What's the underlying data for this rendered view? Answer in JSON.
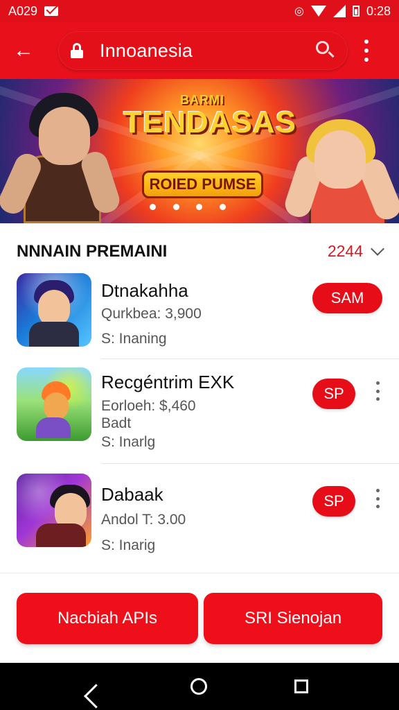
{
  "status_bar": {
    "left_text": "A029",
    "right_text": "0:28"
  },
  "app_bar": {
    "title": "Innoanesia"
  },
  "banner": {
    "title_small": "BARMI",
    "title_main": "TENDASAS",
    "subtitle": "ROIED PUMSE",
    "indicator_count": 4
  },
  "section": {
    "title": "NNNAIN PREMAINI",
    "count": "2244"
  },
  "apps": [
    {
      "name": "Dtnakahha",
      "line1": "Qurkbea: 3,900",
      "line2": "",
      "line3": "S: Inaning",
      "action": "SAM"
    },
    {
      "name": "Recgéntrim EXK",
      "line1": "Eorloeh: $,460",
      "line2": "Badt",
      "line3": "S: Inarlg",
      "action": "SP"
    },
    {
      "name": "Dabaak",
      "line1": "Andol T: 3.00",
      "line2": "",
      "line3": "S: Inarig",
      "action": "SP"
    }
  ],
  "bottom_actions": {
    "left_label": "Nacbiah APIs",
    "right_label": "SRI Sienojan"
  },
  "colors": {
    "primary": "#e8111b",
    "text": "#111111",
    "secondary_text": "#565656"
  }
}
